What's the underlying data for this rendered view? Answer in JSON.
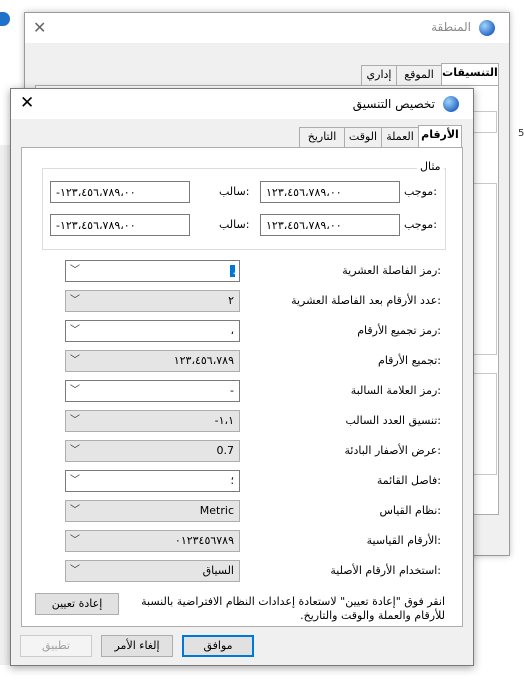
{
  "background": {
    "corner_number": "5"
  },
  "region_window": {
    "title": "المنطقة",
    "tabs": [
      "التنسيقات",
      "الموقع",
      "إداري"
    ],
    "selected_tab": "التنسيقات"
  },
  "dialog": {
    "title": "تخصيص التنسيق",
    "tabs": [
      "الأرقام",
      "العملة",
      "الوقت",
      "التاريخ"
    ],
    "selected_tab": "الأرقام",
    "sample": {
      "group_label": "مثال",
      "rows": [
        {
          "positive_label": "موجب:",
          "positive_value": "١٢٣،٤٥٦،٧٨٩،٠٠",
          "negative_label": "سالب:",
          "negative_value": "-١٢٣،٤٥٦،٧٨٩،٠٠"
        },
        {
          "positive_label": "موجب:",
          "positive_value": "١٢٣،٤٥٦،٧٨٩،٠٠",
          "negative_label": "سالب:",
          "negative_value": "-١٢٣،٤٥٦،٧٨٩،٠٠"
        }
      ]
    },
    "settings": [
      {
        "label": "رمز الفاصلة العشرية:",
        "value": ".",
        "editable": true
      },
      {
        "label": "عدد الأرقام بعد الفاصلة العشرية:",
        "value": "٢",
        "editable": false
      },
      {
        "label": "رمز تجميع الأرقام:",
        "value": "،",
        "editable": true
      },
      {
        "label": "تجميع الأرقام:",
        "value": "١٢٣،٤٥٦،٧٨٩",
        "editable": false
      },
      {
        "label": "رمز العلامة السالبة:",
        "value": "-",
        "editable": true
      },
      {
        "label": "تنسيق العدد السالب:",
        "value": "-١،١",
        "editable": false
      },
      {
        "label": "عرض الأصفار البادئة:",
        "value": "0.7",
        "editable": false
      },
      {
        "label": "فاصل القائمة:",
        "value": "؛",
        "editable": true
      },
      {
        "label": "نظام القياس:",
        "value": "Metric",
        "editable": false
      },
      {
        "label": "الأرقام القياسية:",
        "value": "٠١٢٣٤٥٦٧٨٩",
        "editable": false
      },
      {
        "label": "استخدام الأرقام الأصلية:",
        "value": "السياق",
        "editable": false
      }
    ],
    "reset_note": "انقر فوق \"إعادة تعيين\" لاستعادة إعدادات النظام الافتراضية بالنسبة للأرقام والعملة والوقت والتاريخ.",
    "reset_button": "إعادة تعيين",
    "ok_button": "موافق",
    "cancel_button": "إلغاء الأمر",
    "apply_button": "تطبيق"
  },
  "colors": {
    "accent": "#0078d7",
    "dialog_bg": "#f0f0f0",
    "readonly_bg": "#e5e5e5"
  }
}
